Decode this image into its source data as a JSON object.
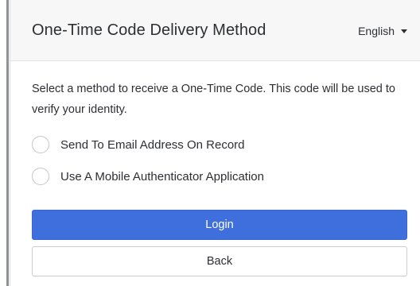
{
  "header": {
    "title": "One-Time Code Delivery Method",
    "language": "English"
  },
  "description": "Select a method to receive a One-Time Code.  This code will be used to verify your identity.",
  "options": [
    {
      "label": "Send To Email Address On Record",
      "selected": false
    },
    {
      "label": "Use A Mobile Authenticator Application",
      "selected": false
    }
  ],
  "buttons": {
    "login": "Login",
    "back": "Back"
  },
  "colors": {
    "primary": "#3f6fdc",
    "text": "#2d2f33",
    "header_bg": "#f7f7f8"
  }
}
